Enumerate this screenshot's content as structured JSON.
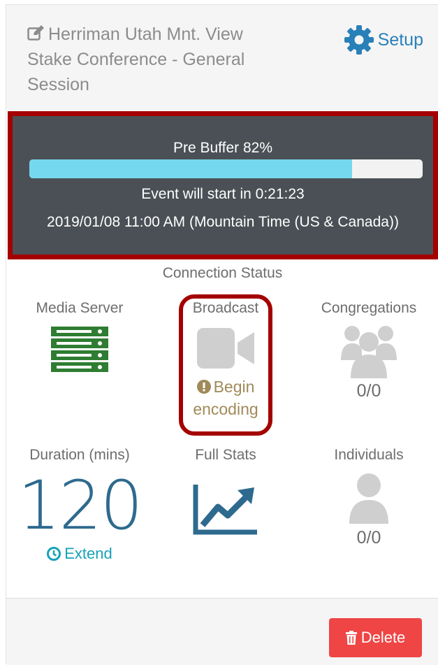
{
  "header": {
    "title_line1": "Herriman Utah Mnt. View",
    "title_line2": "Stake Conference - General",
    "title_line3": "Session",
    "setup_label": "Setup"
  },
  "prebuffer": {
    "label": "Pre Buffer 82%",
    "progress": 0.82,
    "countdown": "Event will start in 0:21:23",
    "datetime": "2019/01/08 11:00 AM (Mountain Time (US & Canada))"
  },
  "connection": {
    "title": "Connection Status",
    "media_server": {
      "label": "Media Server",
      "icon": "server-icon"
    },
    "broadcast": {
      "label": "Broadcast",
      "icon": "video-camera-icon",
      "status_line1": "Begin",
      "status_line2": "encoding"
    },
    "congregations": {
      "label": "Congregations",
      "icon": "group-icon",
      "value": "0/0"
    }
  },
  "stats": {
    "duration": {
      "label": "Duration (mins)",
      "value": "120",
      "extend_label": "Extend"
    },
    "full_stats": {
      "label": "Full Stats",
      "icon": "chart-line-icon"
    },
    "individuals": {
      "label": "Individuals",
      "icon": "user-icon",
      "value": "0/0"
    }
  },
  "footer": {
    "delete_label": "Delete"
  },
  "colors": {
    "accent_blue": "#2980b9",
    "progress_fill": "#76d8ee",
    "highlight_red": "#a40000",
    "server_green": "#2e7d32",
    "delete_red": "#ef4545",
    "warning_tan": "#a08a5a",
    "number_blue": "#2e6a8e"
  }
}
